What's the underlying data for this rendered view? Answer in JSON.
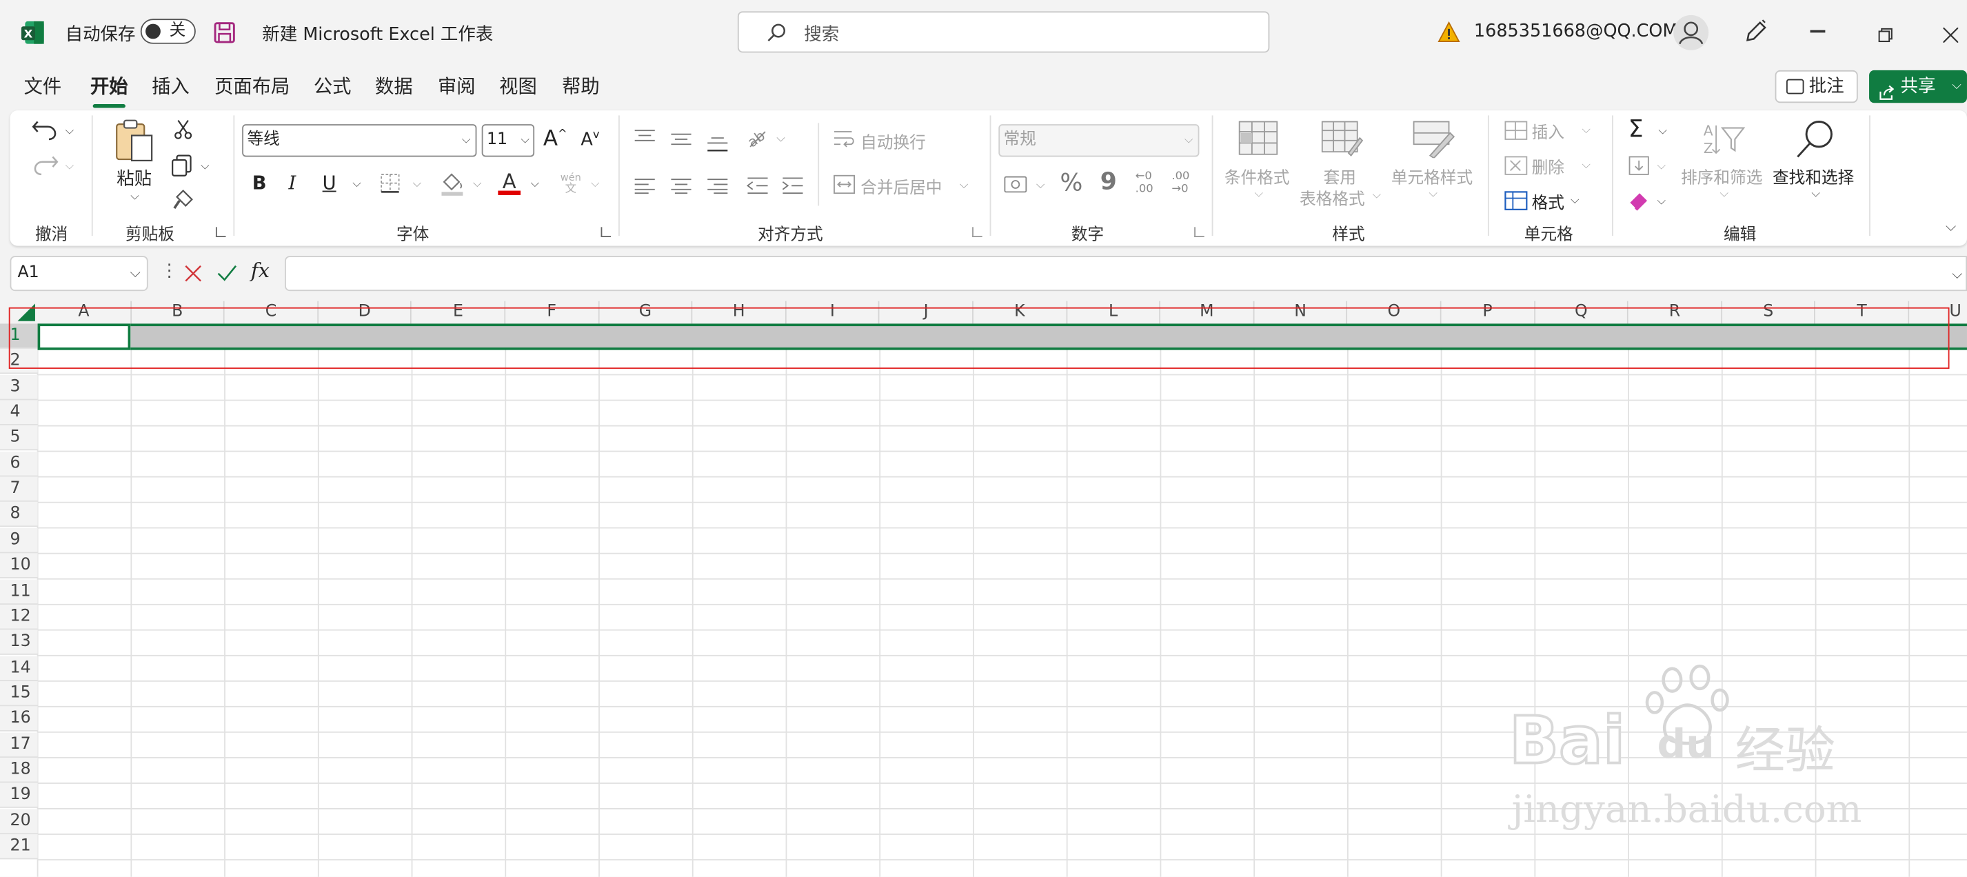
{
  "titlebar": {
    "autosave_label": "自动保存",
    "autosave_state": "关",
    "document_title": "新建 Microsoft Excel 工作表",
    "search_placeholder": "搜索",
    "account": "1685351668@QQ.COM"
  },
  "menu": {
    "tabs": [
      "文件",
      "开始",
      "插入",
      "页面布局",
      "公式",
      "数据",
      "审阅",
      "视图",
      "帮助"
    ],
    "active": "开始",
    "comment_label": "批注",
    "share_label": "共享"
  },
  "ribbon": {
    "undo": {
      "label": "撤消"
    },
    "clipboard": {
      "label": "剪贴板",
      "paste": "粘贴"
    },
    "font": {
      "label": "字体",
      "name": "等线",
      "size": "11",
      "bold": "B",
      "italic": "I",
      "underline": "U",
      "phonetic_top": "wén",
      "phonetic_bottom": "文",
      "font_color": "#e00000"
    },
    "alignment": {
      "label": "对齐方式",
      "wrap": "自动换行",
      "merge": "合并后居中"
    },
    "number": {
      "label": "数字",
      "format": "常规",
      "percent": "%",
      "comma": "9",
      "inc_decimal": ".00",
      "dec_decimal": ".00"
    },
    "styles": {
      "label": "样式",
      "conditional": "条件格式",
      "table_line1": "套用",
      "table_line2": "表格格式",
      "cell_styles": "单元格样式"
    },
    "cells": {
      "label": "单元格",
      "insert": "插入",
      "delete": "删除",
      "format": "格式"
    },
    "editing": {
      "label": "编辑",
      "sort_filter": "排序和筛选",
      "find_select": "查找和选择",
      "sum": "Σ"
    }
  },
  "formula_bar": {
    "cell_ref": "A1",
    "fx": "fx",
    "value": ""
  },
  "sheet": {
    "columns": [
      "A",
      "B",
      "C",
      "D",
      "E",
      "F",
      "G",
      "H",
      "I",
      "J",
      "K",
      "L",
      "M",
      "N",
      "O",
      "P",
      "Q",
      "R",
      "S",
      "T",
      "U"
    ],
    "rows": [
      "1",
      "2",
      "3",
      "4",
      "5",
      "6",
      "7",
      "8",
      "9",
      "10",
      "11",
      "12",
      "13",
      "14",
      "15",
      "16",
      "17",
      "18",
      "19",
      "20",
      "21"
    ],
    "selected_row": "1",
    "active_cell": "A1"
  },
  "watermark": {
    "brand": "Bai",
    "brand2": "du",
    "brand_cn": "经验",
    "url": "jingyan.baidu.com"
  },
  "colors": {
    "accent": "#107c41",
    "highlight": "#e02020",
    "selection_fill": "#c6c6c6"
  }
}
